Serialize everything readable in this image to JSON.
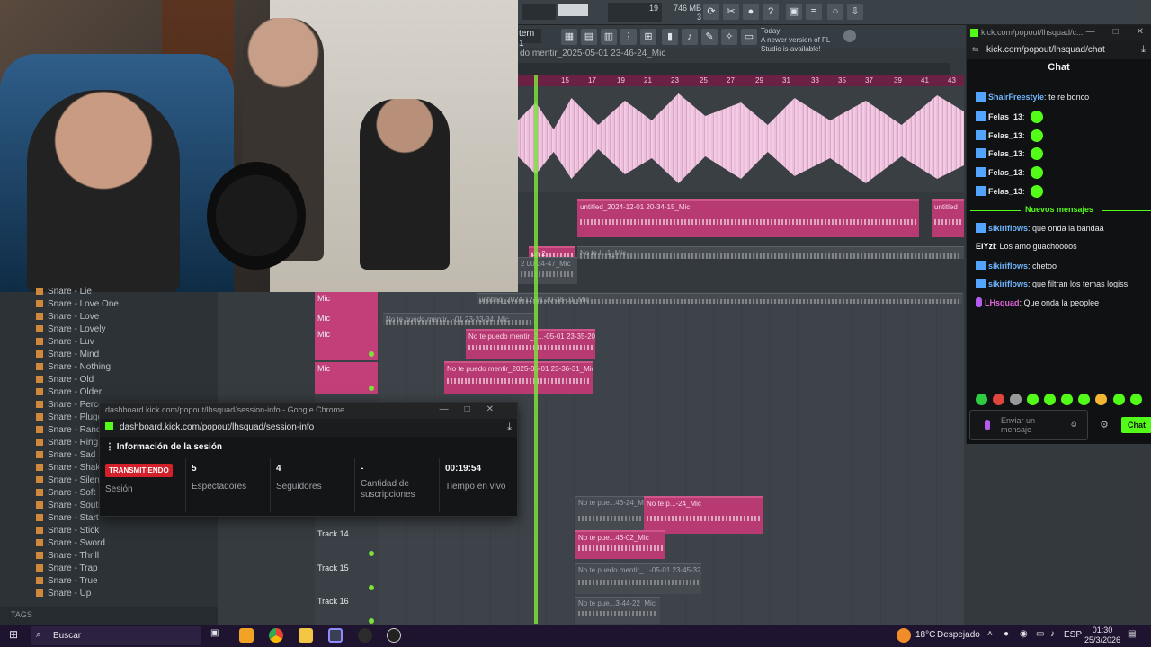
{
  "fl_studio": {
    "cpu_value": "19",
    "mem_value": "746 MB",
    "voices_value": "3",
    "pattern_label": "tern 1",
    "news_today": "Today",
    "news_text": "A newer version of FL Studio is available!",
    "playlist_title": "do mentir_2025-05-01 23-46-24_Mic",
    "ruler_marks": [
      "15",
      "17",
      "19",
      "21",
      "23",
      "25",
      "27",
      "29",
      "31",
      "33",
      "35",
      "37",
      "39",
      "41",
      "43"
    ]
  },
  "browser": {
    "items": [
      "Snare - Lie",
      "Snare - Love One",
      "Snare - Love",
      "Snare - Lovely",
      "Snare - Luv",
      "Snare - Mind",
      "Snare - Nothing",
      "Snare - Old",
      "Snare - Older",
      "Snare - Percus",
      "Snare - Plugg",
      "Snare - Rando",
      "Snare - Ring",
      "Snare - Sad",
      "Snare - Shaker",
      "Snare - Silent",
      "Snare - Soft",
      "Snare - South",
      "Snare - Start",
      "Snare - Stick",
      "Snare - Sword",
      "Snare - Thrill",
      "Snare - Trap",
      "Snare - True",
      "Snare - Up"
    ],
    "tags_label": "TAGS"
  },
  "tracks": [
    {
      "label": "Mic"
    },
    {
      "label": "Mic"
    },
    {
      "label": "Mic"
    },
    {
      "label": "Mic"
    },
    {
      "label": "Track 14"
    },
    {
      "label": "Track 15"
    },
    {
      "label": "Track 16"
    }
  ],
  "clips": [
    "untitled_2024-12-01 20-34-15_Mic",
    "untitled_2024-12-01 20-34-15_Mic",
    "untitled_2024-12-01 20-34-15_Mic",
    "untitled",
    "un 2",
    "No te l...1_Mic",
    "2 00-34-47_Mic",
    "untitled_2024...1 20-38-01_Mic",
    "untitled_2024-1...1 20-38-01_Mic",
    "untitled_2024-12-01 20-38-01_Mic",
    "No te puedo mentir...-01 23-33-34_Mic",
    "No te puedo mentir_2...-05-01 23-35-20_Mic",
    "No te puedo mentir_2025-05-01 23-36-31_Mic",
    "No te pue...46-24_Mic",
    "No te p...-24_Mic",
    "No te pue...6-24_Mic",
    "No te pue...46-02_Mic",
    "No te puedo mentir_...-05-01 23-45-32_Mic",
    "No te pue...3-44-22_Mic"
  ],
  "session_window": {
    "title": "dashboard.kick.com/popout/lhsquad/session-info - Google Chrome",
    "url": "dashboard.kick.com/popout/lhsquad/session-info",
    "heading": "Información de la sesión",
    "status_badge": "TRANSMITIENDO",
    "session_label": "Sesión",
    "viewers_value": "5",
    "viewers_label": "Espectadores",
    "followers_value": "4",
    "followers_label": "Seguidores",
    "subs_value": "-",
    "subs_label": "Cantidad de suscripciones",
    "live_time_value": "00:19:54",
    "live_time_label": "Tiempo en vivo"
  },
  "chat_window": {
    "title": "kick.com/popout/lhsquad/c...",
    "url": "kick.com/popout/lhsquad/chat",
    "header": "Chat",
    "messages_old": [
      {
        "user": "ShairFreestyle",
        "text": "te re bqnco",
        "emote": false
      },
      {
        "user": "Felas_13",
        "text": "",
        "emote": true
      },
      {
        "user": "Felas_13",
        "text": "",
        "emote": true
      },
      {
        "user": "Felas_13",
        "text": "",
        "emote": true
      },
      {
        "user": "Felas_13",
        "text": "",
        "emote": true
      },
      {
        "user": "Felas_13",
        "text": "",
        "emote": true
      }
    ],
    "new_messages_label": "Nuevos mensajes",
    "messages_new": [
      {
        "user": "sikiriflows",
        "text": "que onda la bandaa"
      },
      {
        "user": "ElYzi",
        "text": "Los amo guachoooos"
      },
      {
        "user": "sikiriflows",
        "text": "chetoo"
      },
      {
        "user": "sikiriflows",
        "text": "que filtran los temas logiss"
      },
      {
        "user": "LHsquad",
        "text": "Que onda la peoplee"
      }
    ],
    "input_placeholder": "Enviar un mensaje",
    "send_label": "Chat"
  },
  "taskbar": {
    "search_label": "Buscar",
    "weather": "18°C",
    "weather_text": "Despejado",
    "language": "ESP",
    "time": "01:30",
    "date": "25/3/2026"
  },
  "colors": {
    "kick_green": "#53fc18",
    "fl_pink": "#c23f7a",
    "live_red": "#d4202a"
  }
}
